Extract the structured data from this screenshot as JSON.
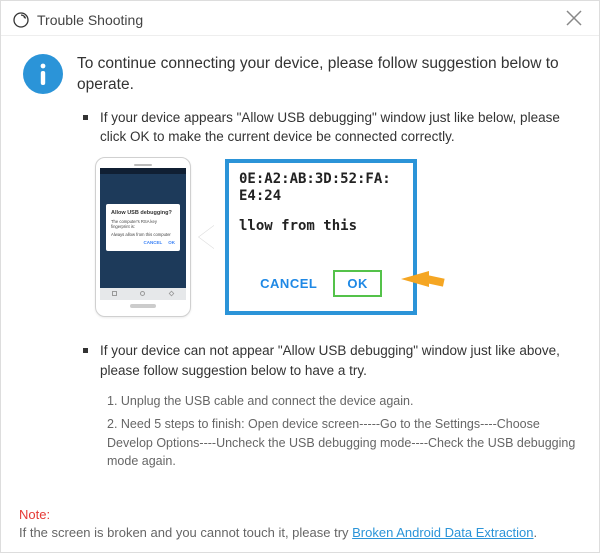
{
  "header": {
    "title": "Trouble Shooting"
  },
  "intro": "To continue connecting your device, please follow suggestion below to operate.",
  "bullet1": "If your device appears \"Allow USB debugging\" window just like below, please click OK to make the current device  be connected correctly.",
  "bullet2": "If your device can not appear \"Allow USB debugging\" window just like above, please follow suggestion below to have a try.",
  "phone_dialog": {
    "title": "Allow USB debugging?",
    "body": "The computer's RSA key fingerprint is:",
    "check": "Always allow from this computer",
    "cancel": "CANCEL",
    "ok": "OK"
  },
  "zoom": {
    "mac_line1": "0E:A2:AB:3D:52:FA:",
    "mac_line2": "E4:24",
    "body": "llow from this",
    "cancel": "CANCEL",
    "ok": "OK"
  },
  "steps": {
    "s1": "1. Unplug the USB cable and connect the device again.",
    "s2": "2. Need 5 steps to finish: Open device screen-----Go to the Settings----Choose Develop Options----Uncheck the USB debugging mode----Check the USB debugging mode again."
  },
  "note": {
    "label": "Note:",
    "body": "If the screen is broken and you cannot touch it, please try ",
    "link": "Broken Android Data Extraction",
    "suffix": "."
  }
}
